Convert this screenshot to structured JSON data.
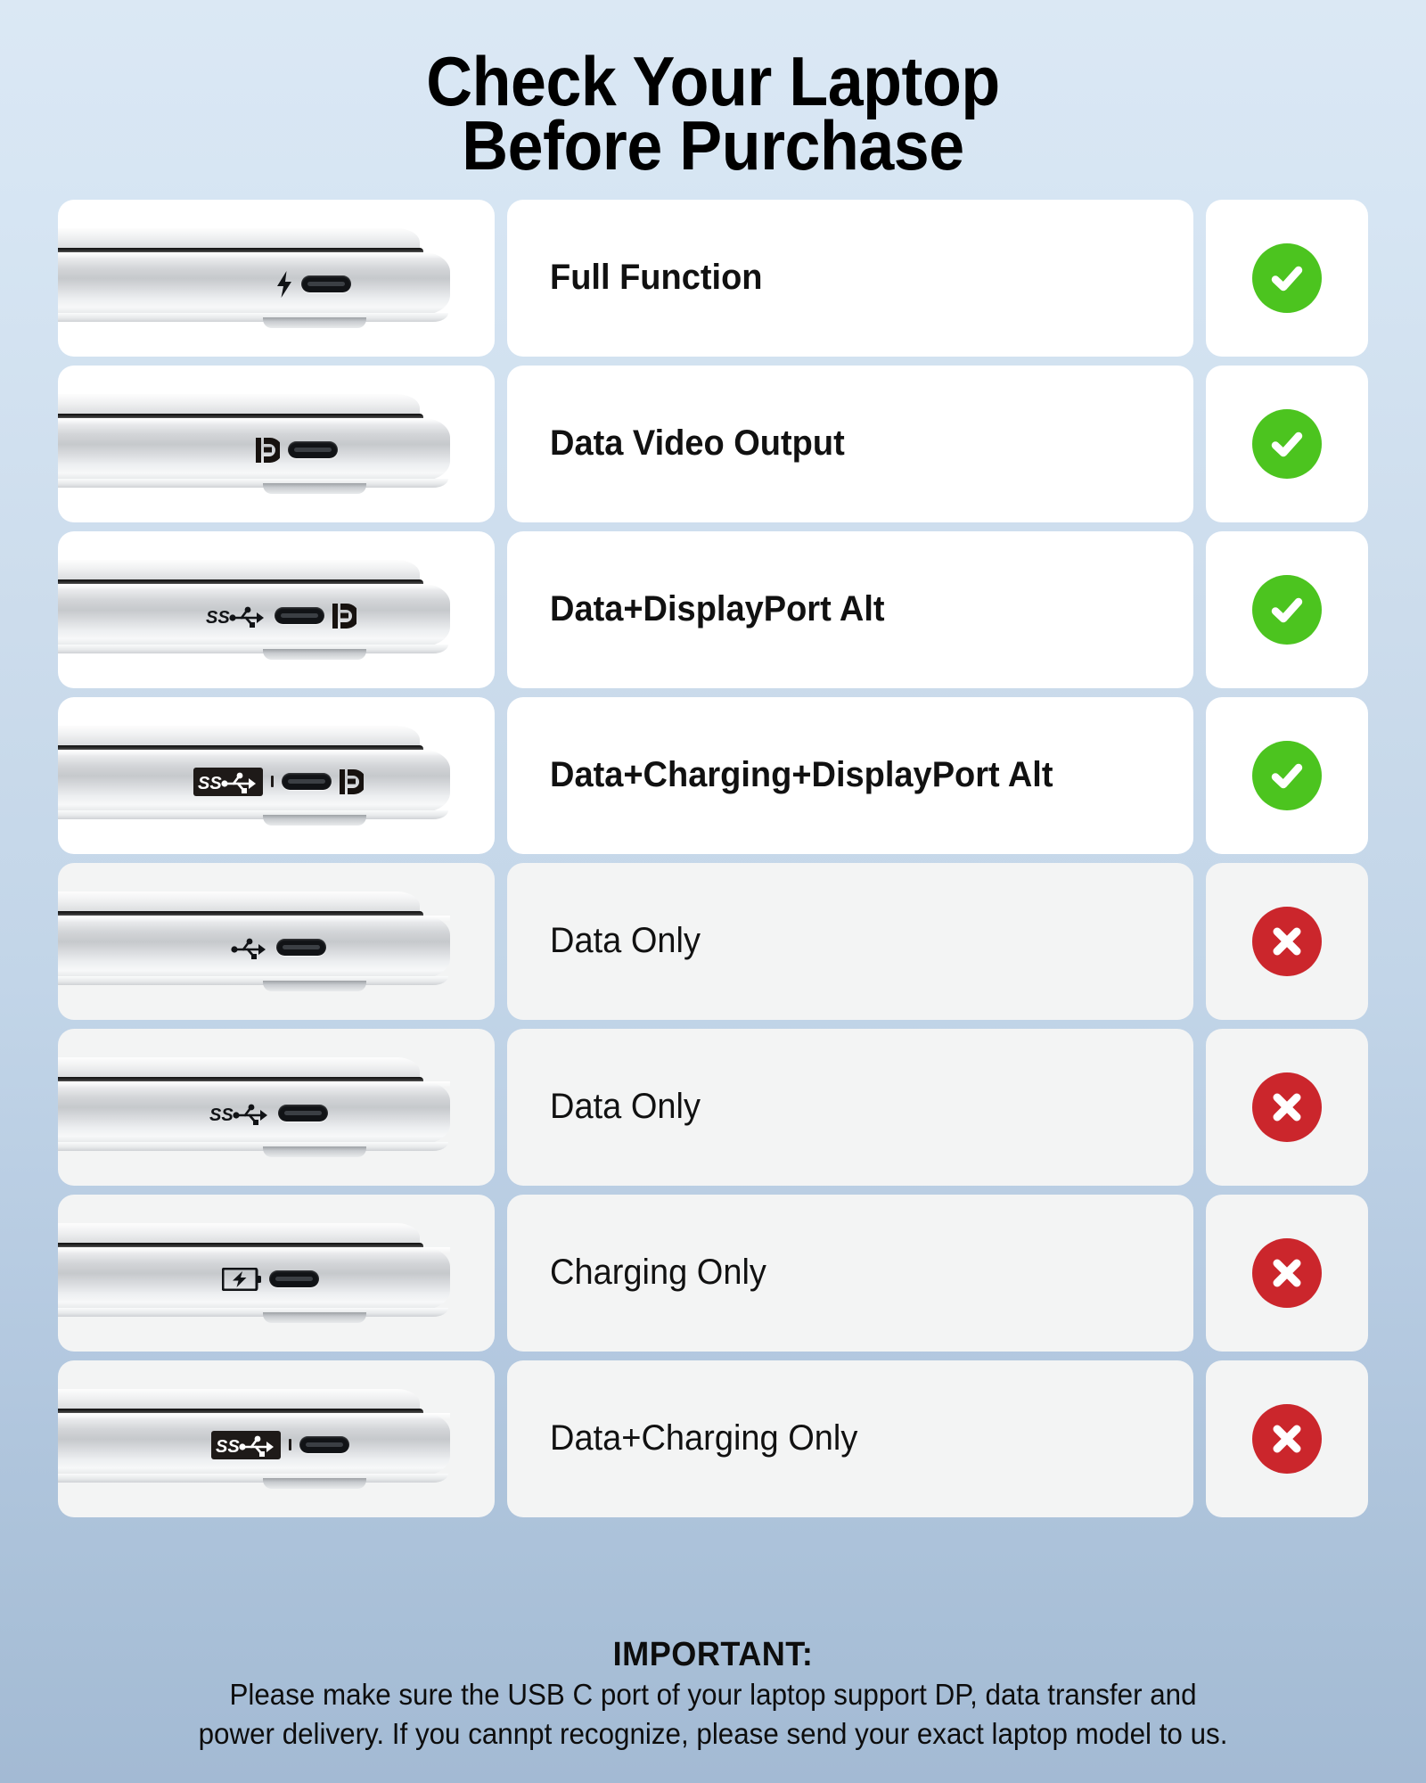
{
  "title": {
    "line1": "Check Your Laptop",
    "line2": "Before Purchase"
  },
  "colors": {
    "yes": "#4cc41f",
    "no": "#cb262c",
    "background_top": "#dbe8f4",
    "background_bottom": "#a3bad4",
    "panel_yes": "#ffffff",
    "panel_no": "#f3f4f4"
  },
  "rows": [
    {
      "label": "Full Function",
      "status": "yes",
      "status_icon": "check-circle-icon",
      "port_icons": [
        "thunderbolt-icon",
        "usb-c-port"
      ]
    },
    {
      "label": "Data Video Output",
      "status": "yes",
      "status_icon": "check-circle-icon",
      "port_icons": [
        "displayport-icon",
        "usb-c-port"
      ]
    },
    {
      "label": "Data+DisplayPort Alt",
      "status": "yes",
      "status_icon": "check-circle-icon",
      "port_icons": [
        "superspeed-usb-icon",
        "usb-c-port",
        "displayport-icon"
      ]
    },
    {
      "label": "Data+Charging+DisplayPort Alt",
      "status": "yes",
      "status_icon": "check-circle-icon",
      "port_icons": [
        "superspeed-usb-charging-icon",
        "usb-c-port",
        "displayport-icon"
      ]
    },
    {
      "label": "Data Only",
      "status": "no",
      "status_icon": "cross-circle-icon",
      "port_icons": [
        "usb-icon",
        "usb-c-port"
      ]
    },
    {
      "label": "Data Only",
      "status": "no",
      "status_icon": "cross-circle-icon",
      "port_icons": [
        "superspeed-usb-icon",
        "usb-c-port"
      ]
    },
    {
      "label": "Charging Only",
      "status": "no",
      "status_icon": "cross-circle-icon",
      "port_icons": [
        "battery-charging-icon",
        "usb-c-port"
      ]
    },
    {
      "label": "Data+Charging Only",
      "status": "no",
      "status_icon": "cross-circle-icon",
      "port_icons": [
        "superspeed-usb-charging-icon",
        "usb-c-port"
      ]
    }
  ],
  "footer": {
    "heading": "IMPORTANT:",
    "line1": "Please make sure the USB C port of your laptop support DP, data transfer and",
    "line2": "power delivery. If you cannpt recognize, please send your exact laptop model to us."
  }
}
